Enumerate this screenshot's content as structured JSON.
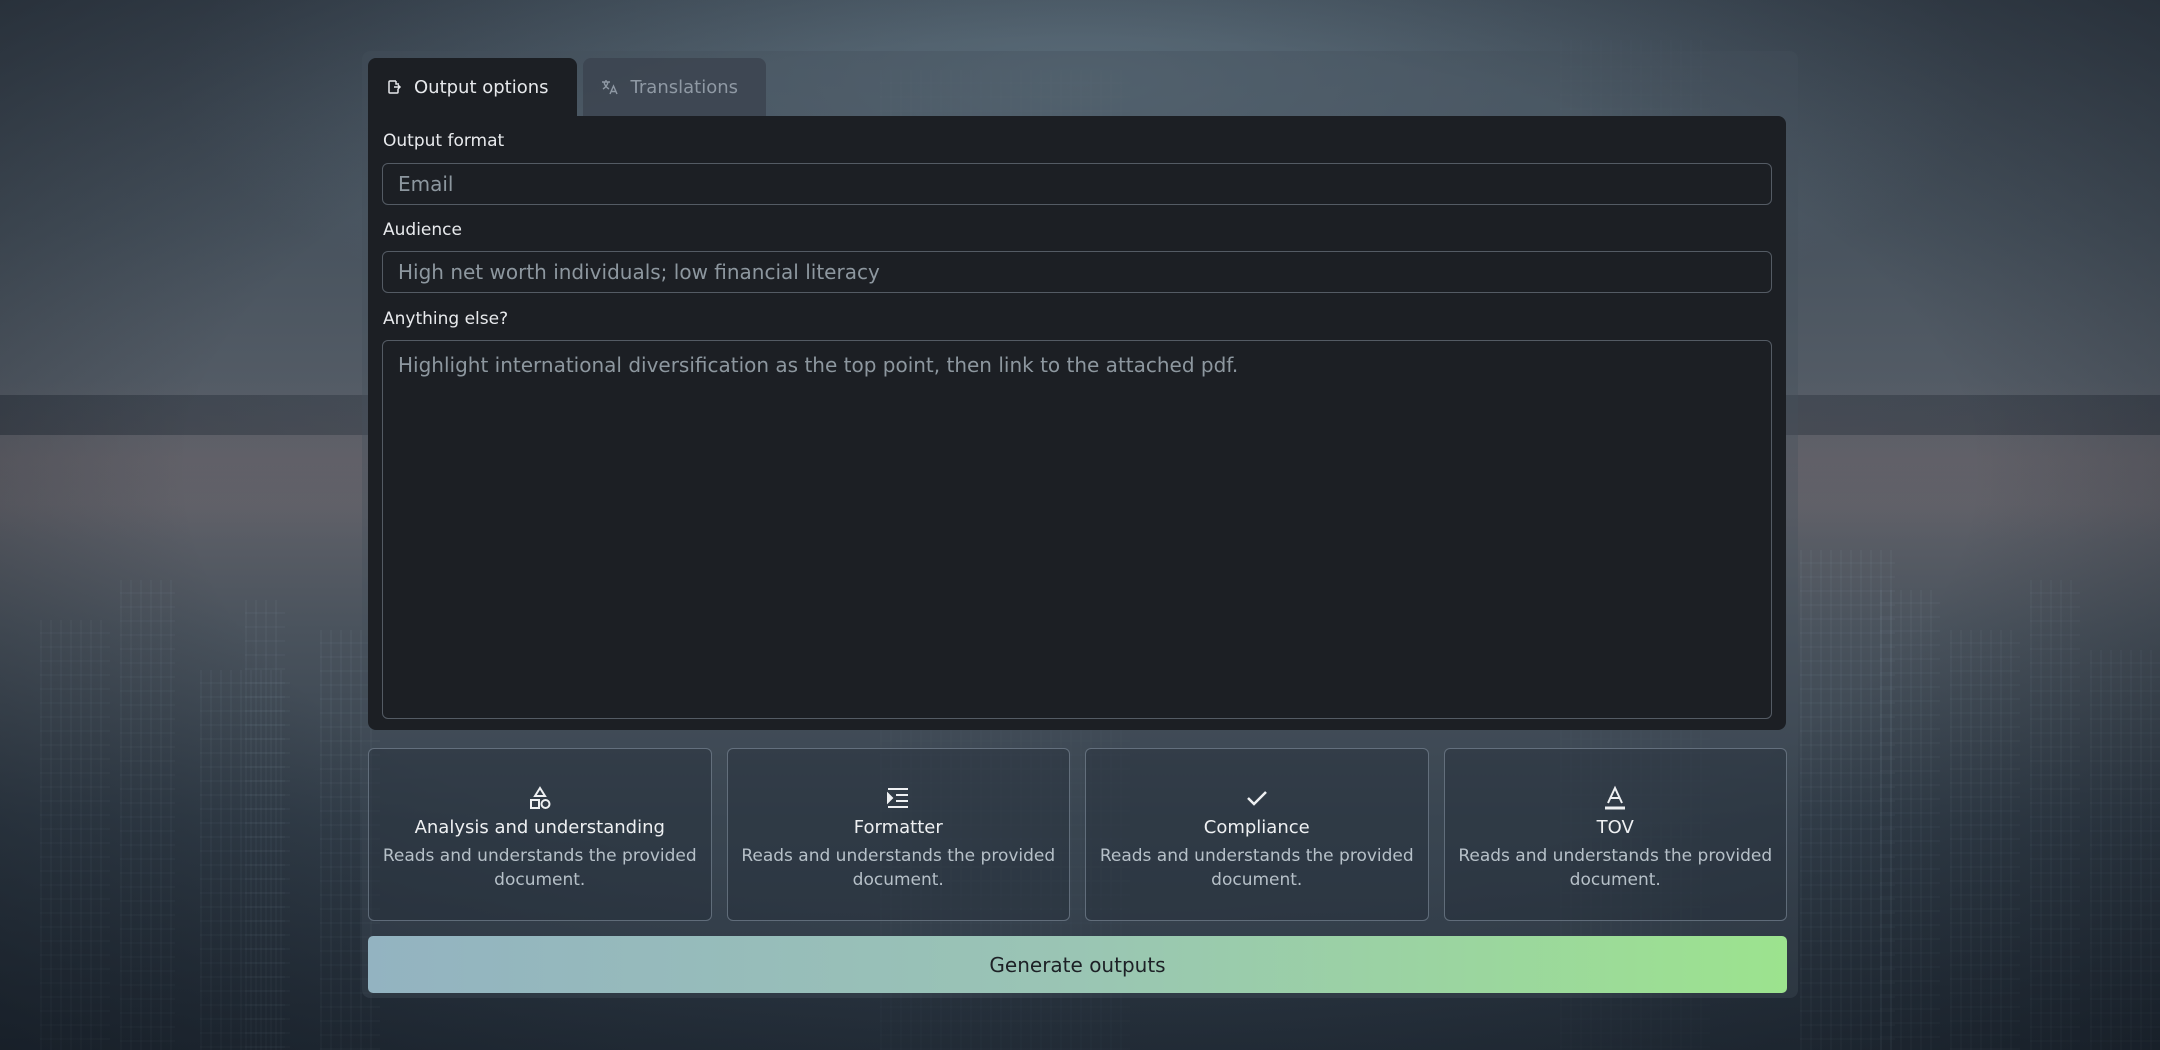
{
  "tabs": [
    {
      "label": "Output options",
      "icon": "file-export-icon",
      "active": true
    },
    {
      "label": "Translations",
      "icon": "translate-icon",
      "active": false
    }
  ],
  "form": {
    "output_format": {
      "label": "Output format",
      "placeholder": "Email"
    },
    "audience": {
      "label": "Audience",
      "placeholder": "High net worth individuals; low financial literacy"
    },
    "anything_else": {
      "label": "Anything else?",
      "placeholder": "Highlight international diversification as the top point, then link to the attached pdf."
    }
  },
  "agents": [
    {
      "title": "Analysis and understanding",
      "description": "Reads and understands the provided document.",
      "icon": "shapes-icon"
    },
    {
      "title": "Formatter",
      "description": "Reads and understands the provided document.",
      "icon": "indent-icon"
    },
    {
      "title": "Compliance",
      "description": "Reads and understands the provided document.",
      "icon": "check-icon"
    },
    {
      "title": "TOV",
      "description": "Reads and understands the provided document.",
      "icon": "text-color-icon"
    }
  ],
  "generate_label": "Generate outputs",
  "colors": {
    "panel": "#1c1f24",
    "button_gradient_start": "#93b3c1",
    "button_gradient_end": "#9ce38e"
  }
}
